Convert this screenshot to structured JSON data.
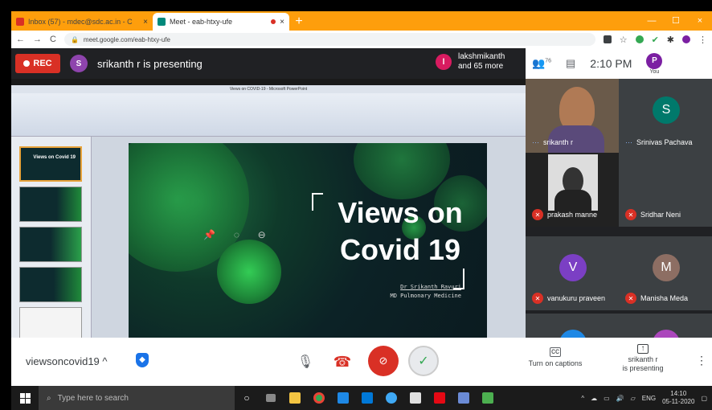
{
  "browser": {
    "tabs": [
      {
        "title": "Inbox (57) - mdec@sdc.ac.in - C",
        "close": "×",
        "active": false
      },
      {
        "title": "Meet - eab-htxy-ufe",
        "close": "×",
        "active": true
      }
    ],
    "new_tab": "+",
    "window_controls": [
      "—",
      "☐",
      "×"
    ],
    "url": "meet.google.com/eab-htxy-ufe"
  },
  "meet": {
    "rec_label": "REC",
    "presenter_initial": "S",
    "presenting_text": "srikanth r is presenting",
    "others_initial": "l",
    "others_line1": "lakshmikanth",
    "others_line2": "and 65 more",
    "people_count": "76",
    "time": "2:10 PM",
    "you_initial": "P",
    "you_label": "You"
  },
  "presentation": {
    "window_title": "Views on COVID-19 - Microsoft PowerPoint",
    "slide_title_line1": "Views on",
    "slide_title_line2": "Covid 19",
    "author_line1": "Dr Srikanth Ravuri",
    "author_line2": "MD Pulmonary Medicine",
    "thumb1_title": "Views on Covid 19"
  },
  "participants": [
    {
      "name": "srikanth r",
      "initial": "",
      "muted": false,
      "video": true,
      "color": "#6a5a4a"
    },
    {
      "name": "Srinivas Pachava",
      "initial": "S",
      "muted": false,
      "video": false,
      "color": "#00796b"
    },
    {
      "name": "prakash manne",
      "initial": "",
      "muted": true,
      "video": true,
      "color": "#2e2a28"
    },
    {
      "name": "Sridhar Neni",
      "initial": "",
      "muted": true,
      "video": false,
      "color": ""
    },
    {
      "name": "vanukuru praveen",
      "initial": "V",
      "muted": true,
      "video": false,
      "color": "#7b3fc4"
    },
    {
      "name": "Manisha Meda",
      "initial": "M",
      "muted": true,
      "video": false,
      "color": "#8d6e63"
    }
  ],
  "bottom": {
    "meeting_name": "viewsoncovid19",
    "captions_label": "Turn on captions",
    "present_line1": "srikanth r",
    "present_line2": "is presenting"
  },
  "taskbar": {
    "search_placeholder": "Type here to search",
    "lang": "ENG",
    "clock_time": "14:10",
    "clock_date": "05-11-2020"
  },
  "colors": {
    "chrome_orange": "#fe9e0c",
    "meet_dark": "#202124",
    "rec_red": "#d93025",
    "accept_green": "#34a853"
  }
}
